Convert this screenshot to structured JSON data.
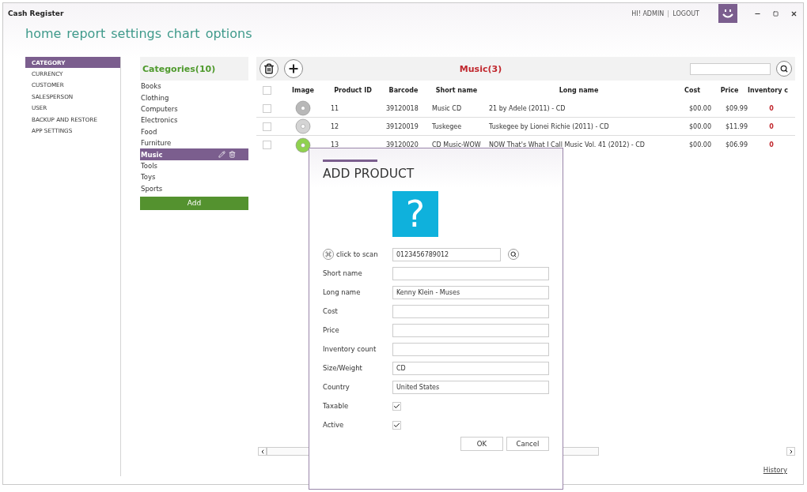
{
  "window": {
    "title": "Cash Register"
  },
  "user_bar": {
    "greeting": "HI! ADMIN",
    "logout": "LOGOUT"
  },
  "nav": [
    {
      "label": "home"
    },
    {
      "label": "report"
    },
    {
      "label": "settings"
    },
    {
      "label": "chart"
    },
    {
      "label": "options"
    }
  ],
  "sidebar": {
    "items": [
      {
        "label": "CATEGORY",
        "selected": true
      },
      {
        "label": "CURRENCY",
        "selected": false
      },
      {
        "label": "CUSTOMER",
        "selected": false
      },
      {
        "label": "SALESPERSON",
        "selected": false
      },
      {
        "label": "USER",
        "selected": false
      },
      {
        "label": "BACKUP AND RESTORE",
        "selected": false
      },
      {
        "label": "APP SETTINGS",
        "selected": false
      }
    ]
  },
  "categories": {
    "title": "Categories(10)",
    "add_button": "Add",
    "items": [
      {
        "label": "Books",
        "selected": false
      },
      {
        "label": "Clothing",
        "selected": false
      },
      {
        "label": "Computers",
        "selected": false
      },
      {
        "label": "Electronics",
        "selected": false
      },
      {
        "label": "Food",
        "selected": false
      },
      {
        "label": "Furniture",
        "selected": false
      },
      {
        "label": "Music",
        "selected": true
      },
      {
        "label": "Tools",
        "selected": false
      },
      {
        "label": "Toys",
        "selected": false
      },
      {
        "label": "Sports",
        "selected": false
      }
    ]
  },
  "products": {
    "title": "Music(3)",
    "select_all_checked": false,
    "columns": [
      "Image",
      "Product ID",
      "Barcode",
      "Short name",
      "Long name",
      "Cost",
      "Price",
      "Inventory c"
    ],
    "rows": [
      {
        "checked": false,
        "color": "#b8b8b8",
        "product_id": "11",
        "barcode": "39120018",
        "short_name": "Music CD",
        "long_name": "21 by Adele (2011) - CD",
        "cost": "$00.00",
        "price": "$09.99",
        "inventory": "0"
      },
      {
        "checked": false,
        "color": "#d4d4d4",
        "product_id": "12",
        "barcode": "39120019",
        "short_name": "Tuskegee",
        "long_name": "Tuskegee by Lionei Richie (2011) - CD",
        "cost": "$00.00",
        "price": "$11.99",
        "inventory": "0"
      },
      {
        "checked": false,
        "color": "#8fd14f",
        "product_id": "13",
        "barcode": "39120020",
        "short_name": "CD Music-WOW",
        "long_name": "NOW That's What I Call Music Vol. 41 (2012) - CD",
        "cost": "$00.00",
        "price": "$06.99",
        "inventory": "0"
      }
    ],
    "history_link": "History"
  },
  "dialog": {
    "title": "ADD PRODUCT",
    "image_mark": "?",
    "scan_label": "click to scan",
    "barcode": "0123456789012",
    "fields": [
      {
        "kind": "text",
        "label": "Short name"
      },
      {
        "kind": "text",
        "label": "Long name",
        "value": "Kenny Klein - Muses"
      },
      {
        "kind": "text",
        "label": "Cost"
      },
      {
        "kind": "text",
        "label": "Price"
      },
      {
        "kind": "text",
        "label": "Inventory count"
      },
      {
        "kind": "text",
        "label": "Size/Weight",
        "value": "CD"
      },
      {
        "kind": "text",
        "label": "Country",
        "value": "United States"
      },
      {
        "kind": "checkbox",
        "label": "Taxable",
        "checked": true
      },
      {
        "kind": "checkbox",
        "label": "Active",
        "checked": true
      }
    ],
    "buttons": [
      "OK",
      "Cancel"
    ]
  }
}
